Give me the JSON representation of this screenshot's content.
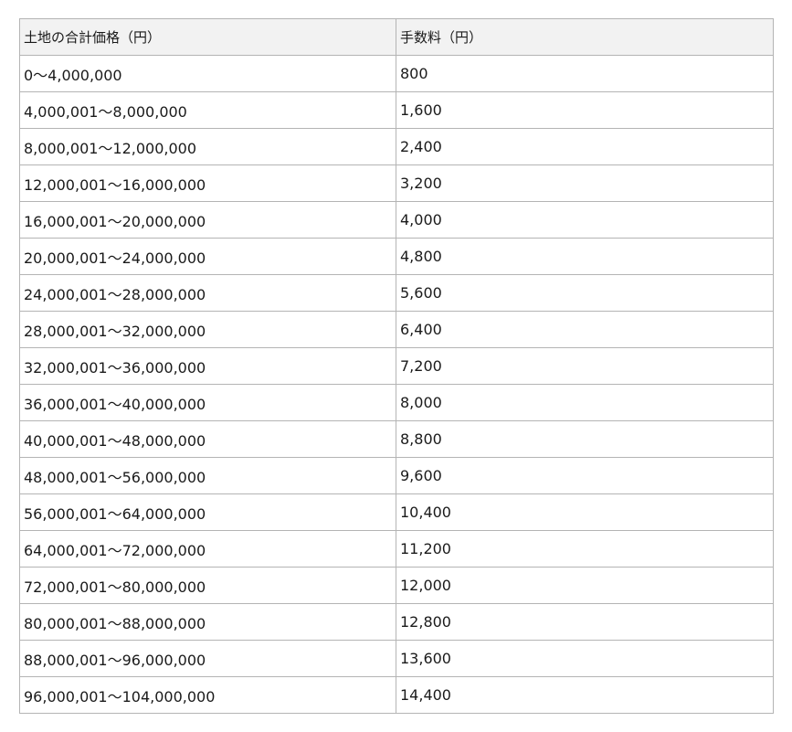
{
  "table": {
    "headers": [
      "土地の合計価格（円）",
      "手数料（円）"
    ],
    "rows": [
      [
        "0～4,000,000",
        "800"
      ],
      [
        "4,000,001～8,000,000",
        "1,600"
      ],
      [
        "8,000,001～12,000,000",
        "2,400"
      ],
      [
        "12,000,001～16,000,000",
        "3,200"
      ],
      [
        "16,000,001～20,000,000",
        "4,000"
      ],
      [
        "20,000,001～24,000,000",
        "4,800"
      ],
      [
        "24,000,001～28,000,000",
        "5,600"
      ],
      [
        "28,000,001～32,000,000",
        "6,400"
      ],
      [
        "32,000,001～36,000,000",
        "7,200"
      ],
      [
        "36,000,001～40,000,000",
        "8,000"
      ],
      [
        "40,000,001～48,000,000",
        "8,800"
      ],
      [
        "48,000,001～56,000,000",
        "9,600"
      ],
      [
        "56,000,001～64,000,000",
        "10,400"
      ],
      [
        "64,000,001～72,000,000",
        "11,200"
      ],
      [
        "72,000,001～80,000,000",
        "12,000"
      ],
      [
        "80,000,001～88,000,000",
        "12,800"
      ],
      [
        "88,000,001～96,000,000",
        "13,600"
      ],
      [
        "96,000,001～104,000,000",
        "14,400"
      ]
    ]
  }
}
